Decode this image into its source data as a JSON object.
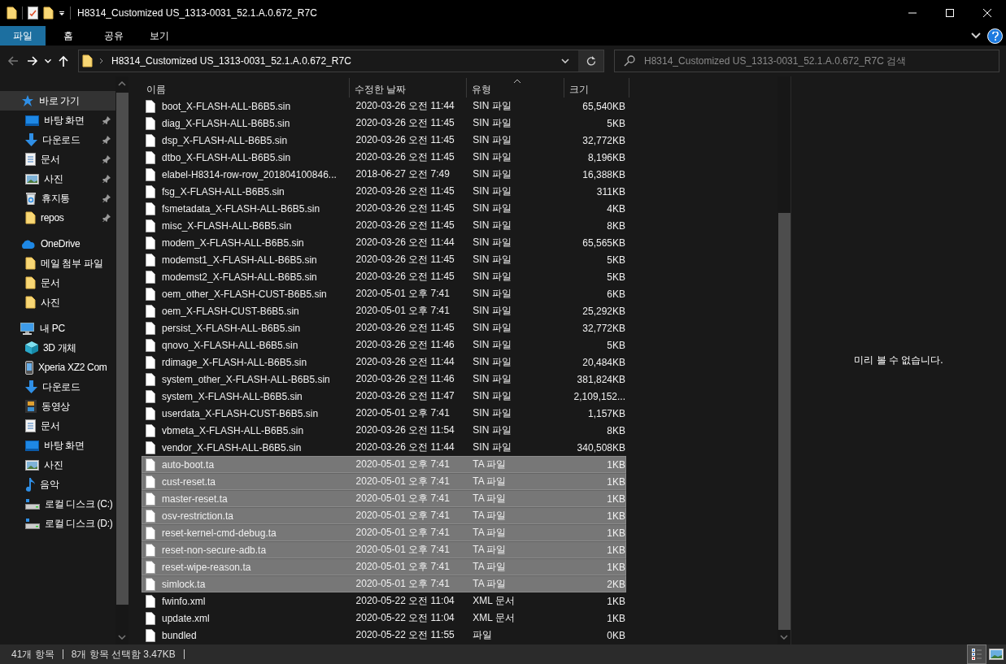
{
  "window": {
    "title": "H8314_Customized US_1313-0031_52.1.A.0.672_R7C"
  },
  "ribbon_tabs": [
    {
      "label": "파일",
      "selected": true
    },
    {
      "label": "홈",
      "selected": false
    },
    {
      "label": "공유",
      "selected": false
    },
    {
      "label": "보기",
      "selected": false
    }
  ],
  "nav_buttons": [
    {
      "kind": "back",
      "disabled": true
    },
    {
      "kind": "forward",
      "disabled": false
    },
    {
      "kind": "recent",
      "disabled": false
    },
    {
      "kind": "up",
      "disabled": false
    }
  ],
  "address": {
    "path": "H8314_Customized US_1313-0031_52.1.A.0.672_R7C"
  },
  "search": {
    "placeholder": "H8314_Customized US_1313-0031_52.1.A.0.672_R7C 검색"
  },
  "sidebar": {
    "items": [
      {
        "label": "바로 가기",
        "kind": "star",
        "selected": true,
        "children": [
          {
            "label": "바탕 화면",
            "kind": "desktop",
            "pinned": true
          },
          {
            "label": "다운로드",
            "kind": "download",
            "pinned": true
          },
          {
            "label": "문서",
            "kind": "documents",
            "pinned": true
          },
          {
            "label": "사진",
            "kind": "pictures",
            "pinned": true
          },
          {
            "label": "휴지통",
            "kind": "recycle",
            "pinned": true
          },
          {
            "label": "repos",
            "kind": "folder",
            "pinned": true
          }
        ]
      },
      {
        "label": "OneDrive",
        "kind": "cloud",
        "selected": false,
        "children": [
          {
            "label": "메일 첨부 파일",
            "kind": "folder",
            "pinned": false
          },
          {
            "label": "문서",
            "kind": "folder",
            "pinned": false
          },
          {
            "label": "사진",
            "kind": "folder",
            "pinned": false
          }
        ]
      },
      {
        "label": "내 PC",
        "kind": "pc",
        "selected": false,
        "children": [
          {
            "label": "3D 개체",
            "kind": "cube",
            "pinned": false
          },
          {
            "label": "Xperia XZ2 Com",
            "kind": "phone",
            "pinned": false
          },
          {
            "label": "다운로드",
            "kind": "download",
            "pinned": false
          },
          {
            "label": "동영상",
            "kind": "video",
            "pinned": false
          },
          {
            "label": "문서",
            "kind": "documents",
            "pinned": false
          },
          {
            "label": "바탕 화면",
            "kind": "desktop",
            "pinned": false
          },
          {
            "label": "사진",
            "kind": "pictures",
            "pinned": false
          },
          {
            "label": "음악",
            "kind": "music",
            "pinned": false
          },
          {
            "label": "로컬 디스크 (C:)",
            "kind": "drive",
            "pinned": false
          },
          {
            "label": "로컬 디스크 (D:)",
            "kind": "drive",
            "pinned": false
          }
        ]
      }
    ]
  },
  "table": {
    "columns": [
      {
        "label": "이름",
        "sorted": false
      },
      {
        "label": "수정한 날짜",
        "sorted": false
      },
      {
        "label": "유형",
        "sorted": true
      },
      {
        "label": "크기",
        "sorted": false
      }
    ],
    "rows": [
      {
        "name": "boot_X-FLASH-ALL-B6B5.sin",
        "date": "2020-03-26 오전 11:44",
        "type": "SIN 파일",
        "size": "65,540KB",
        "selected": false
      },
      {
        "name": "diag_X-FLASH-ALL-B6B5.sin",
        "date": "2020-03-26 오전 11:45",
        "type": "SIN 파일",
        "size": "5KB",
        "selected": false
      },
      {
        "name": "dsp_X-FLASH-ALL-B6B5.sin",
        "date": "2020-03-26 오전 11:45",
        "type": "SIN 파일",
        "size": "32,772KB",
        "selected": false
      },
      {
        "name": "dtbo_X-FLASH-ALL-B6B5.sin",
        "date": "2020-03-26 오전 11:45",
        "type": "SIN 파일",
        "size": "8,196KB",
        "selected": false
      },
      {
        "name": "elabel-H8314-row-row_201804100846...",
        "date": "2018-06-27 오전 7:49",
        "type": "SIN 파일",
        "size": "16,388KB",
        "selected": false
      },
      {
        "name": "fsg_X-FLASH-ALL-B6B5.sin",
        "date": "2020-03-26 오전 11:45",
        "type": "SIN 파일",
        "size": "311KB",
        "selected": false
      },
      {
        "name": "fsmetadata_X-FLASH-ALL-B6B5.sin",
        "date": "2020-03-26 오전 11:45",
        "type": "SIN 파일",
        "size": "4KB",
        "selected": false
      },
      {
        "name": "misc_X-FLASH-ALL-B6B5.sin",
        "date": "2020-03-26 오전 11:45",
        "type": "SIN 파일",
        "size": "8KB",
        "selected": false
      },
      {
        "name": "modem_X-FLASH-ALL-B6B5.sin",
        "date": "2020-03-26 오전 11:44",
        "type": "SIN 파일",
        "size": "65,565KB",
        "selected": false
      },
      {
        "name": "modemst1_X-FLASH-ALL-B6B5.sin",
        "date": "2020-03-26 오전 11:45",
        "type": "SIN 파일",
        "size": "5KB",
        "selected": false
      },
      {
        "name": "modemst2_X-FLASH-ALL-B6B5.sin",
        "date": "2020-03-26 오전 11:45",
        "type": "SIN 파일",
        "size": "5KB",
        "selected": false
      },
      {
        "name": "oem_other_X-FLASH-CUST-B6B5.sin",
        "date": "2020-05-01 오후 7:41",
        "type": "SIN 파일",
        "size": "6KB",
        "selected": false
      },
      {
        "name": "oem_X-FLASH-CUST-B6B5.sin",
        "date": "2020-05-01 오후 7:41",
        "type": "SIN 파일",
        "size": "25,292KB",
        "selected": false
      },
      {
        "name": "persist_X-FLASH-ALL-B6B5.sin",
        "date": "2020-03-26 오전 11:45",
        "type": "SIN 파일",
        "size": "32,772KB",
        "selected": false
      },
      {
        "name": "qnovo_X-FLASH-ALL-B6B5.sin",
        "date": "2020-03-26 오전 11:46",
        "type": "SIN 파일",
        "size": "5KB",
        "selected": false
      },
      {
        "name": "rdimage_X-FLASH-ALL-B6B5.sin",
        "date": "2020-03-26 오전 11:44",
        "type": "SIN 파일",
        "size": "20,484KB",
        "selected": false
      },
      {
        "name": "system_other_X-FLASH-ALL-B6B5.sin",
        "date": "2020-03-26 오전 11:46",
        "type": "SIN 파일",
        "size": "381,824KB",
        "selected": false
      },
      {
        "name": "system_X-FLASH-ALL-B6B5.sin",
        "date": "2020-03-26 오전 11:47",
        "type": "SIN 파일",
        "size": "2,109,152...",
        "selected": false
      },
      {
        "name": "userdata_X-FLASH-CUST-B6B5.sin",
        "date": "2020-05-01 오후 7:41",
        "type": "SIN 파일",
        "size": "1,157KB",
        "selected": false
      },
      {
        "name": "vbmeta_X-FLASH-ALL-B6B5.sin",
        "date": "2020-03-26 오전 11:54",
        "type": "SIN 파일",
        "size": "8KB",
        "selected": false
      },
      {
        "name": "vendor_X-FLASH-ALL-B6B5.sin",
        "date": "2020-03-26 오전 11:44",
        "type": "SIN 파일",
        "size": "340,508KB",
        "selected": false
      },
      {
        "name": "auto-boot.ta",
        "date": "2020-05-01 오후 7:41",
        "type": "TA 파일",
        "size": "1KB",
        "selected": true
      },
      {
        "name": "cust-reset.ta",
        "date": "2020-05-01 오후 7:41",
        "type": "TA 파일",
        "size": "1KB",
        "selected": true
      },
      {
        "name": "master-reset.ta",
        "date": "2020-05-01 오후 7:41",
        "type": "TA 파일",
        "size": "1KB",
        "selected": true
      },
      {
        "name": "osv-restriction.ta",
        "date": "2020-05-01 오후 7:41",
        "type": "TA 파일",
        "size": "1KB",
        "selected": true
      },
      {
        "name": "reset-kernel-cmd-debug.ta",
        "date": "2020-05-01 오후 7:41",
        "type": "TA 파일",
        "size": "1KB",
        "selected": true
      },
      {
        "name": "reset-non-secure-adb.ta",
        "date": "2020-05-01 오후 7:41",
        "type": "TA 파일",
        "size": "1KB",
        "selected": true
      },
      {
        "name": "reset-wipe-reason.ta",
        "date": "2020-05-01 오후 7:41",
        "type": "TA 파일",
        "size": "1KB",
        "selected": true
      },
      {
        "name": "simlock.ta",
        "date": "2020-05-01 오후 7:41",
        "type": "TA 파일",
        "size": "2KB",
        "selected": true
      },
      {
        "name": "fwinfo.xml",
        "date": "2020-05-22 오전 11:04",
        "type": "XML 문서",
        "size": "1KB",
        "selected": false
      },
      {
        "name": "update.xml",
        "date": "2020-05-22 오전 11:04",
        "type": "XML 문서",
        "size": "1KB",
        "selected": false
      },
      {
        "name": "bundled",
        "date": "2020-05-22 오전 11:55",
        "type": "파일",
        "size": "0KB",
        "selected": false
      }
    ]
  },
  "preview": {
    "message": "미리 볼 수 없습니다."
  },
  "status_bar": {
    "item_count": "41개 항목",
    "selection": "8개 항목 선택함 3.47KB"
  },
  "view_buttons": [
    {
      "kind": "details",
      "selected": true
    },
    {
      "kind": "large-icons",
      "selected": false
    }
  ]
}
